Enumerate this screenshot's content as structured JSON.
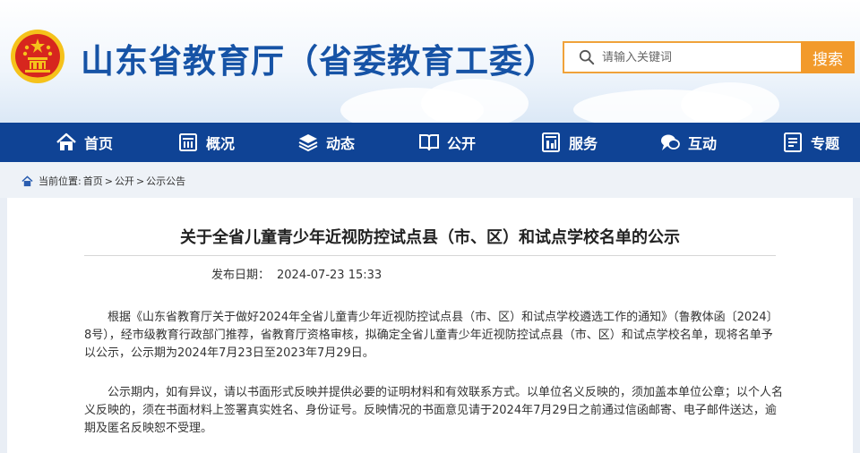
{
  "header": {
    "site_title": "山东省教育厅（省委教育工委）",
    "search_placeholder": "请输入关键词",
    "search_button": "搜索"
  },
  "nav": {
    "items": [
      {
        "label": "首页",
        "icon": "home-icon"
      },
      {
        "label": "概况",
        "icon": "building-icon"
      },
      {
        "label": "动态",
        "icon": "layers-icon"
      },
      {
        "label": "公开",
        "icon": "book-icon"
      },
      {
        "label": "服务",
        "icon": "service-icon"
      },
      {
        "label": "互动",
        "icon": "chat-icon"
      },
      {
        "label": "专题",
        "icon": "document-icon"
      }
    ]
  },
  "breadcrumb": {
    "prefix": "当前位置:",
    "items": [
      "首页",
      "公开",
      "公示公告"
    ],
    "separator": ">"
  },
  "article": {
    "title": "关于全省儿童青少年近视防控试点县（市、区）和试点学校名单的公示",
    "date_label": "发布日期：",
    "date_value": "2024-07-23 15:33",
    "paragraph1": "根据《山东省教育厅关于做好2024年全省儿童青少年近视防控试点县（市、区）和试点学校遴选工作的通知》（鲁教体函〔2024〕8号），经市级教育行政部门推荐，省教育厅资格审核，拟确定全省儿童青少年近视防控试点县（市、区）和试点学校名单，现将名单予以公示，公示期为2024年7月23日至2023年7月29日。",
    "paragraph2": "公示期内，如有异议，请以书面形式反映并提供必要的证明材料和有效联系方式。以单位名义反映的，须加盖本单位公章；以个人名义反映的，须在书面材料上签署真实姓名、身份证号。反映情况的书面意见请于2024年7月29日之前通过信函邮寄、电子邮件送达，逾期及匿名反映恕不受理。"
  },
  "colors": {
    "nav_bg": "#0f4395",
    "title_blue": "#1653a6",
    "search_orange": "#f29a2b",
    "emblem_red": "#d7261e",
    "emblem_gold": "#f5c21b"
  }
}
